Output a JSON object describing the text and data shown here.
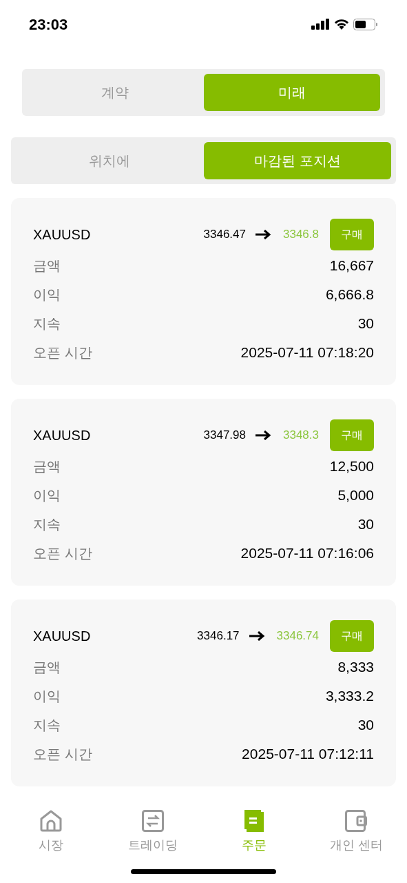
{
  "status_bar": {
    "time": "23:03"
  },
  "market_tabs": [
    {
      "label": "계약",
      "selected": false
    },
    {
      "label": "미래",
      "selected": true
    }
  ],
  "position_tabs": [
    {
      "label": "위치에",
      "selected": false
    },
    {
      "label": "마감된 포지션",
      "selected": true
    }
  ],
  "orders": [
    {
      "symbol": "XAUUSD",
      "open_price": "3346.47",
      "close_price": "3346.8",
      "side": "구매",
      "fields": [
        {
          "label": "금액",
          "value": "16,667"
        },
        {
          "label": "이익",
          "value": "6,666.8"
        },
        {
          "label": "지속",
          "value": "30"
        },
        {
          "label": "오픈 시간",
          "value": "2025-07-11 07:18:20"
        }
      ]
    },
    {
      "symbol": "XAUUSD",
      "open_price": "3347.98",
      "close_price": "3348.3",
      "side": "구매",
      "fields": [
        {
          "label": "금액",
          "value": "12,500"
        },
        {
          "label": "이익",
          "value": "5,000"
        },
        {
          "label": "지속",
          "value": "30"
        },
        {
          "label": "오픈 시간",
          "value": "2025-07-11 07:16:06"
        }
      ]
    },
    {
      "symbol": "XAUUSD",
      "open_price": "3346.17",
      "close_price": "3346.74",
      "side": "구매",
      "fields": [
        {
          "label": "금액",
          "value": "8,333"
        },
        {
          "label": "이익",
          "value": "3,333.2"
        },
        {
          "label": "지속",
          "value": "30"
        },
        {
          "label": "오픈 시간",
          "value": "2025-07-11 07:12:11"
        }
      ]
    }
  ],
  "bottom_nav": [
    {
      "kind": "home",
      "label": "시장",
      "selected": false
    },
    {
      "kind": "exchange",
      "label": "트레이딩",
      "selected": false
    },
    {
      "kind": "orders",
      "label": "주문",
      "selected": true
    },
    {
      "kind": "wallet",
      "label": "개인 센터",
      "selected": false
    }
  ]
}
